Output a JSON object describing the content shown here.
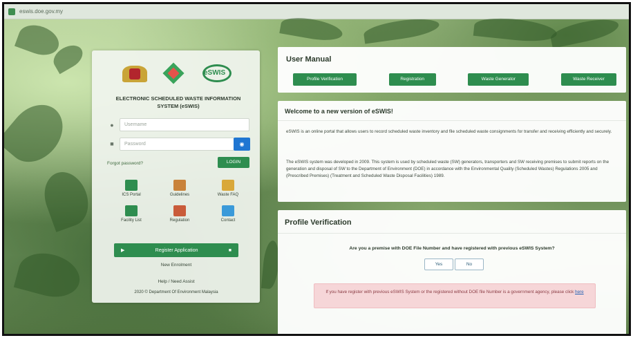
{
  "browser": {
    "url": "eswis.doe.gov.my"
  },
  "login": {
    "system_title": "ELECTRONIC SCHEDULED WASTE INFORMATION SYSTEM (eSWIS)",
    "eswis_logo_text": "eSWIS",
    "user_placeholder": "Username",
    "password_placeholder": "Password",
    "forgot_label": "Forgot password?",
    "login_label": "LOGIN",
    "menu": [
      {
        "label": "ICS Portal",
        "color": "#2e8d4f"
      },
      {
        "label": "Guidelines",
        "color": "#c9823a"
      },
      {
        "label": "Waste FAQ",
        "color": "#d9a83a"
      },
      {
        "label": "Facility List",
        "color": "#2e8d4f"
      },
      {
        "label": "Regulation",
        "color": "#c95b3a"
      },
      {
        "label": "Contact",
        "color": "#3a9ad9"
      }
    ],
    "register_label": "Register Application",
    "new_enrolment_label": "New Enrolment",
    "help_label": "Help / Need Assist",
    "copyright": "2020 © Department Of Environment Malaysia"
  },
  "manual": {
    "title": "User Manual",
    "tabs": [
      "Profile Verification",
      "Registration",
      "Waste Generator",
      "Waste Receiver"
    ]
  },
  "welcome": {
    "title": "Welcome to a new version of eSWIS!",
    "para1": "eSWIS is an online portal that allows users to record scheduled waste inventory and file scheduled waste consignments for transfer and receiving efficiently and securely.",
    "para2": "The eSWIS system was developed in 2009. This system is used by scheduled waste (SW) generators, transporters and SW receiving premises to submit reports on the generation and disposal of SW to the Department of Environment (DOE) in accordance with the Environmental Quality (Scheduled Wastes) Regulations 2005 and (Prescribed Premises) (Treatment and Scheduled Waste Disposal Facilities) 1989."
  },
  "verification": {
    "title": "Profile Verification",
    "question": "Are you a premise with DOE File Number and have registered with previous eSWIS System?",
    "yes_label": "Yes",
    "no_label": "No",
    "alert_text": "If you have register with previous eSWIS System or the registered without DOE file Number is a government agency, please click",
    "alert_link": "here"
  }
}
